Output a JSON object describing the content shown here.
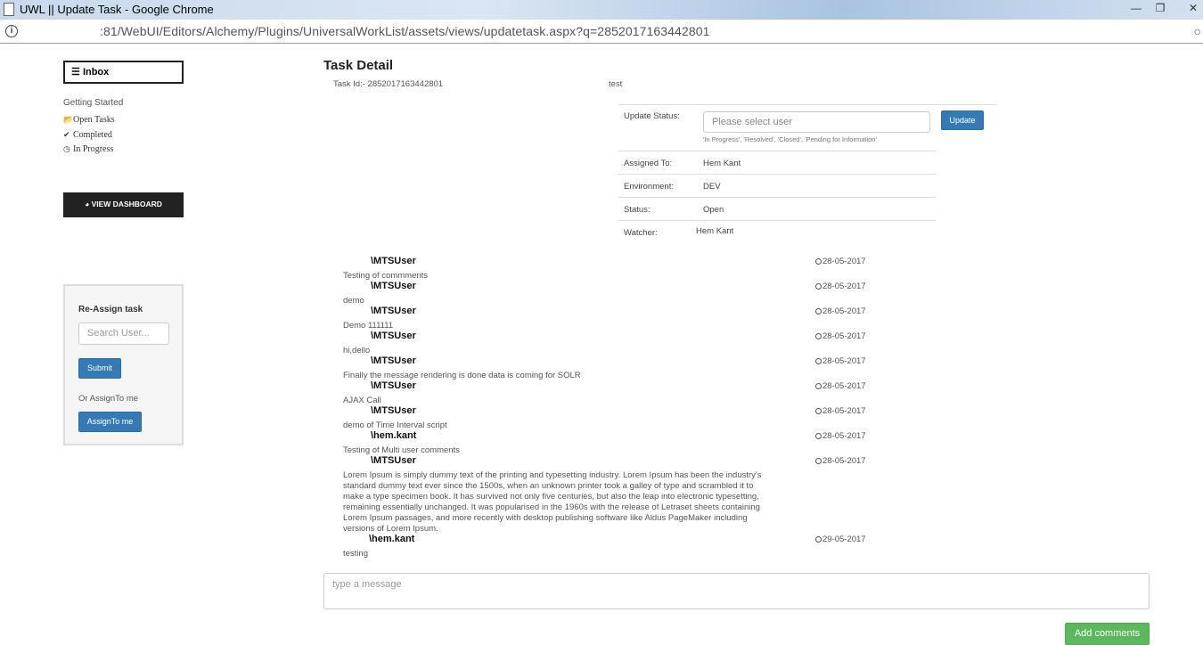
{
  "window": {
    "title": "UWL || Update Task - Google Chrome",
    "url": ":81/WebUI/Editors/Alchemy/Plugins/UniversalWorkList/assets/views/updatetask.aspx?q=2852017163442801"
  },
  "sidebar": {
    "inbox_label": "Inbox",
    "nav_heading": "Getting Started",
    "items": [
      {
        "icon": "folder-open-icon",
        "label": "Open Tasks"
      },
      {
        "icon": "check-circle-icon",
        "label": "Completed"
      },
      {
        "icon": "clock-icon",
        "label": "In Progress"
      }
    ],
    "dashboard_label": "VIEW DASHBOARD"
  },
  "reassign": {
    "title": "Re-Assign task",
    "search_placeholder": "Search User...",
    "submit_label": "Submit",
    "or_label": "Or AssignTo me",
    "assign_label": "AssignTo me"
  },
  "task": {
    "heading": "Task Detail",
    "id_text": "Task Id:- 2852017163442801",
    "name": "test",
    "update_status_label": "Update Status:",
    "status_placeholder": "Please select user",
    "status_help": "'In Progress', 'Resolved', 'Closed', 'Pending for Information'",
    "update_button": "Update",
    "fields": [
      {
        "label": "Assigned To:",
        "value": "Hem Kant"
      },
      {
        "label": "Environment:",
        "value": "DEV"
      },
      {
        "label": "Status:",
        "value": "Open"
      },
      {
        "label": "Watcher:",
        "value": "Hem Kant"
      }
    ]
  },
  "comments": [
    {
      "user": "\\MTSUser",
      "date": "28-05-2017",
      "text": "Testing of commments"
    },
    {
      "user": "\\MTSUser",
      "date": "28-05-2017",
      "text": "demo"
    },
    {
      "user": "\\MTSUser",
      "date": "28-05-2017",
      "text": "Demo 111111"
    },
    {
      "user": "\\MTSUser",
      "date": "28-05-2017",
      "text": "hi,dello"
    },
    {
      "user": "\\MTSUser",
      "date": "28-05-2017",
      "text": "Finally the message rendering is done data is coming for SOLR"
    },
    {
      "user": "\\MTSUser",
      "date": "28-05-2017",
      "text": "AJAX Call"
    },
    {
      "user": "\\MTSUser",
      "date": "28-05-2017",
      "text": "demo of Time Interval script"
    },
    {
      "user": "\\hem.kant",
      "date": "28-05-2017",
      "text": "Testing of Multi user comments"
    },
    {
      "user": "\\MTSUser",
      "date": "28-05-2017",
      "text": "Lorem Ipsum is simply dummy text of the printing and typesetting industry. Lorem Ipsum has been the industry's standard dummy text ever since the 1500s, when an unknown printer took a galley of type and scrambled it to make a type specimen book. It has survived not only five centuries, but also the leap into electronic typesetting, remaining essentially unchanged. It was popularised in the 1960s with the release of Letraset sheets containing Lorem Ipsum passages, and more recently with desktop publishing software like Aldus PageMaker including versions of Lorem Ipsum."
    },
    {
      "user": "\\hem.kant",
      "date": "29-05-2017",
      "text": "testing"
    }
  ],
  "composer": {
    "placeholder": "type a message",
    "add_label": "Add comments"
  }
}
